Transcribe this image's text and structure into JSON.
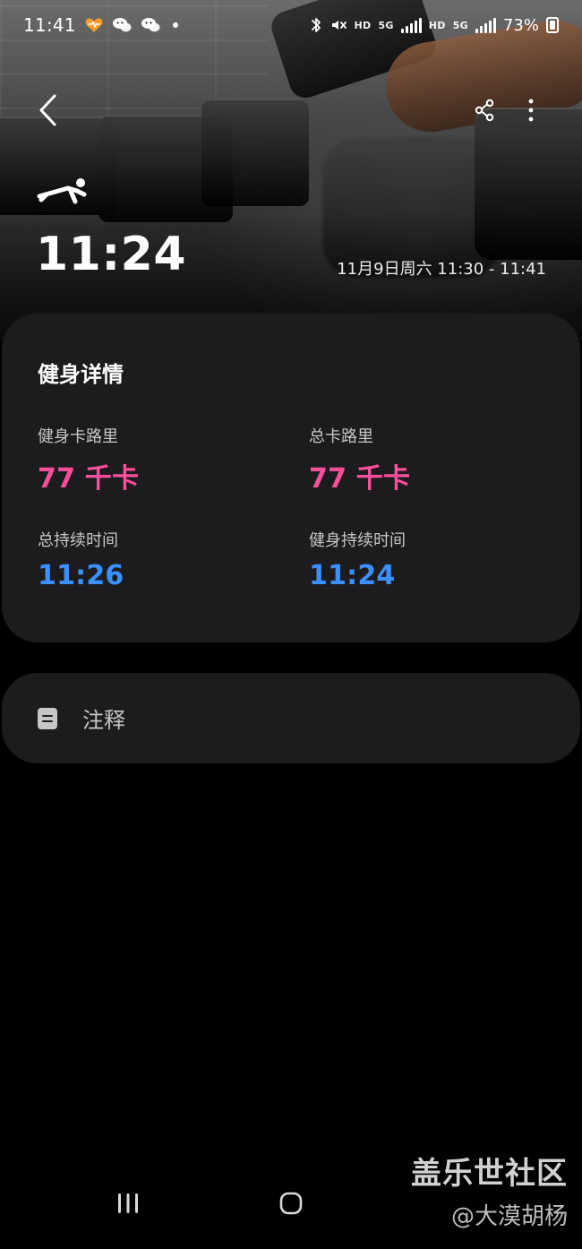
{
  "status_bar": {
    "time": "11:41",
    "battery_percent": "73%",
    "hd_labels": [
      "HD",
      "HD"
    ],
    "network_labels": [
      "5G",
      "5G"
    ],
    "icons": [
      "health-app-icon",
      "wechat-icon",
      "wechat-icon",
      "notification-dot-icon",
      "bluetooth-icon",
      "mute-icon",
      "signal-icon",
      "battery-icon"
    ]
  },
  "header": {
    "back_icon": "chevron-left-icon",
    "share_icon": "share-icon",
    "more_icon": "more-vertical-icon"
  },
  "workout": {
    "icon": "exercise-icon",
    "duration": "11:24",
    "date_range": "11月9日周六 11:30 - 11:41"
  },
  "details": {
    "title": "健身详情",
    "metrics": [
      {
        "label": "健身卡路里",
        "value": "77 千卡",
        "color": "#ff4f9a"
      },
      {
        "label": "总卡路里",
        "value": "77 千卡",
        "color": "#ff4f9a"
      },
      {
        "label": "总持续时间",
        "value": "11:26",
        "color": "#3b90ff"
      },
      {
        "label": "健身持续时间",
        "value": "11:24",
        "color": "#3b90ff"
      }
    ]
  },
  "notes": {
    "icon": "note-icon",
    "label": "注释"
  },
  "watermark": {
    "title": "盖乐世社区",
    "user": "@大漠胡杨"
  },
  "navbar": {
    "icons": [
      "recents-icon",
      "home-icon"
    ]
  },
  "colors": {
    "background": "#000000",
    "card": "#1c1c1f",
    "pink": "#ff4f9a",
    "blue": "#3b90ff"
  }
}
